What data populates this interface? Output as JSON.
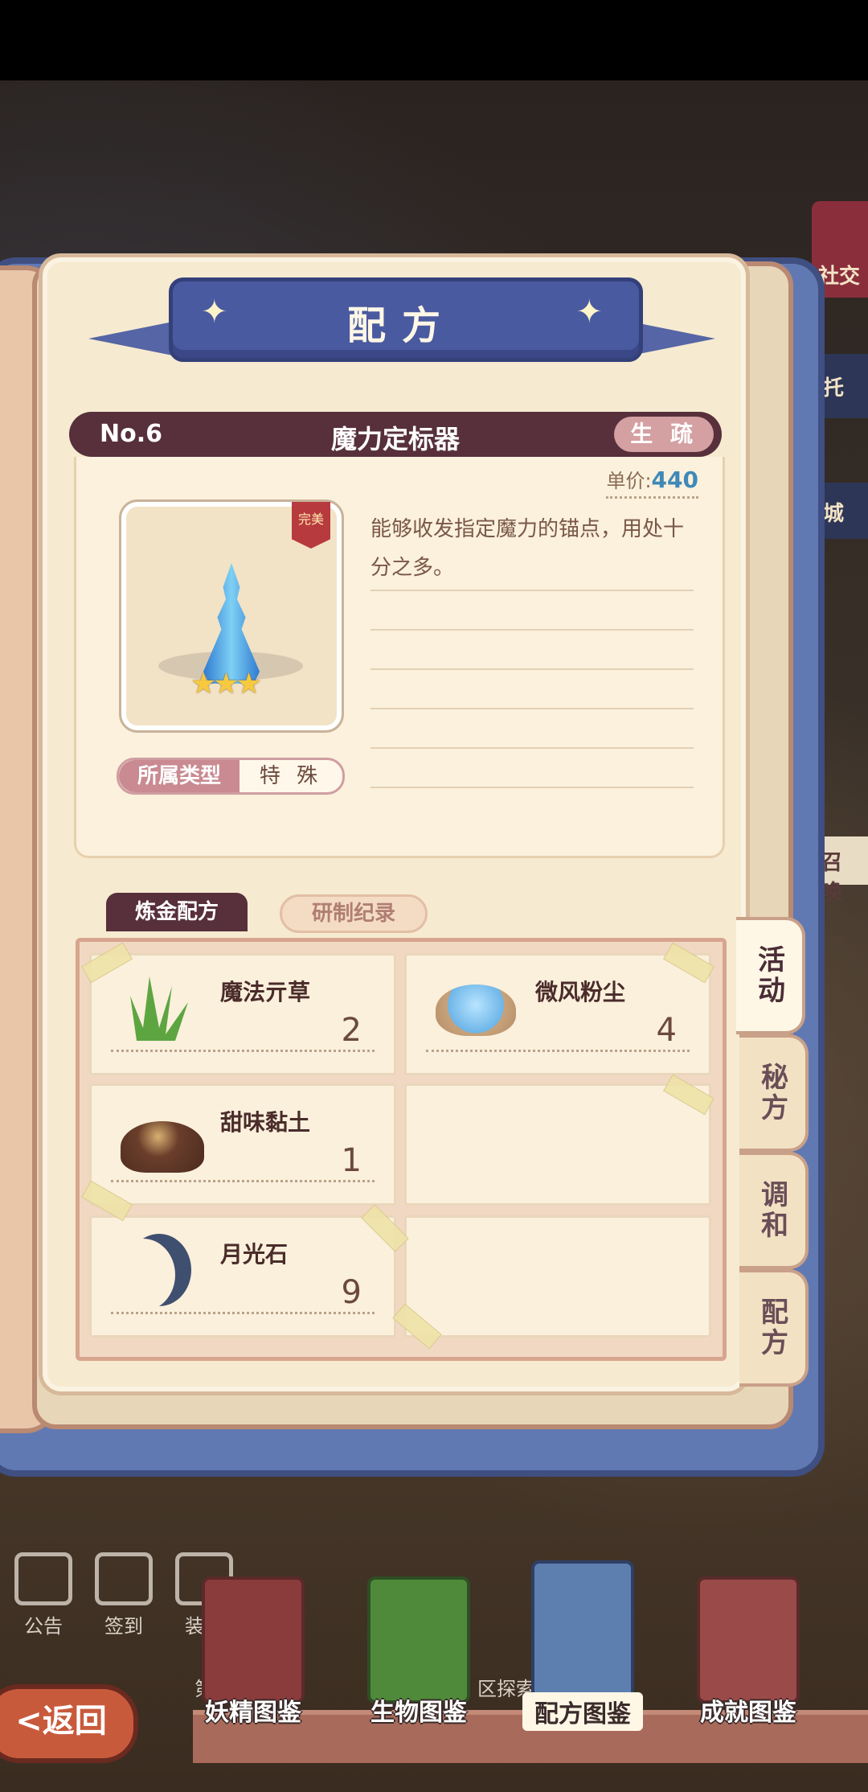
{
  "window": {
    "title": "配方"
  },
  "side_hud": {
    "social": "社交",
    "entrust": "托",
    "shop": "城",
    "summon": "召 唤"
  },
  "item": {
    "number": "No.6",
    "name": "魔力定标器",
    "familiarity": "生 疏",
    "price_label": "单价:",
    "price_value": "440",
    "quality": "完美",
    "stars": "★★★",
    "type_label": "所属类型",
    "type_value": "特 殊",
    "description": "能够收发指定魔力的锚点，用处十分之多。"
  },
  "tabs": {
    "recipe": "炼金配方",
    "records": "研制纪录"
  },
  "ingredients": [
    {
      "name": "魔法亓草",
      "qty": "2",
      "icon": "herb-icon"
    },
    {
      "name": "微风粉尘",
      "qty": "4",
      "icon": "dust-icon"
    },
    {
      "name": "甜味黏土",
      "qty": "1",
      "icon": "clay-icon"
    },
    {
      "name": "",
      "qty": "",
      "icon": ""
    },
    {
      "name": "月光石",
      "qty": "9",
      "icon": "moon-icon"
    },
    {
      "name": "",
      "qty": "",
      "icon": ""
    }
  ],
  "side_tabs": [
    "活动",
    "秘方",
    "调和",
    "配方"
  ],
  "hud": {
    "notice": "公告",
    "checkin": "签到",
    "decor": "装饰",
    "explore": "区探索",
    "first": "第"
  },
  "bottom_nav": [
    "妖精图鉴",
    "生物图鉴",
    "配方图鉴",
    "成就图鉴"
  ],
  "back": "<返回"
}
